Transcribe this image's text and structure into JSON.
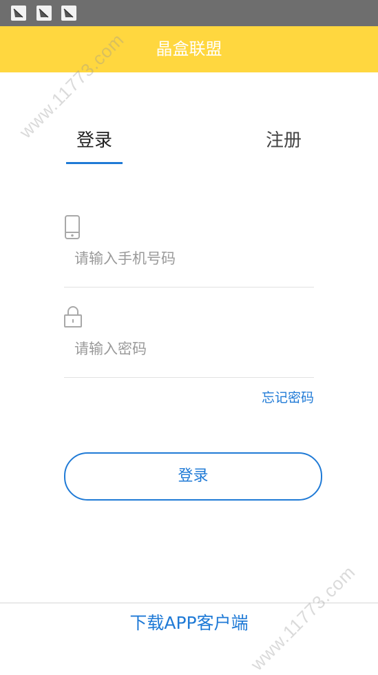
{
  "app": {
    "title": "晶盒联盟"
  },
  "status_bar": {
    "icons": [
      "signal-icon",
      "signal-icon",
      "signal-icon"
    ]
  },
  "tabs": [
    {
      "label": "登录",
      "active": true
    },
    {
      "label": "注册",
      "active": false
    }
  ],
  "phone_field": {
    "icon": "phone-icon",
    "placeholder": "请输入手机号码",
    "value": ""
  },
  "password_field": {
    "icon": "lock-icon",
    "placeholder": "请输入密码",
    "value": ""
  },
  "forgot_password_label": "忘记密码",
  "login_button_label": "登录",
  "download_label": "下载APP客户端",
  "watermark": "www.11773.com",
  "colors": {
    "accent": "#1f7ad6",
    "header": "#ffd73f",
    "status_bar": "#6e6e6e"
  }
}
